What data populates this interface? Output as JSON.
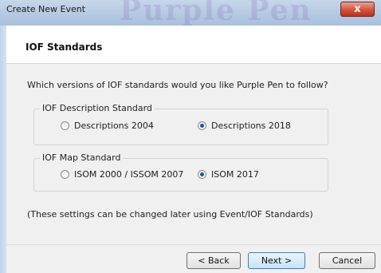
{
  "window": {
    "title": "Create New Event",
    "watermark": "Purple Pen",
    "close_glyph": "x"
  },
  "header": {
    "title": "IOF Standards"
  },
  "question": "Which versions of IOF standards would you like Purple Pen to follow?",
  "description_group": {
    "legend": "IOF Description Standard",
    "options": [
      {
        "label": "Descriptions 2004",
        "selected": false
      },
      {
        "label": "Descriptions 2018",
        "selected": true
      }
    ]
  },
  "map_group": {
    "legend": "IOF Map Standard",
    "options": [
      {
        "label": "ISOM 2000 / ISSOM 2007",
        "selected": false
      },
      {
        "label": "ISOM 2017",
        "selected": true
      }
    ]
  },
  "note": "(These settings can be changed later using Event/IOF Standards)",
  "buttons": {
    "back": "< Back",
    "next": "Next >",
    "cancel": "Cancel"
  },
  "colors": {
    "accent": "#1a56a8",
    "close": "#c7402a"
  }
}
